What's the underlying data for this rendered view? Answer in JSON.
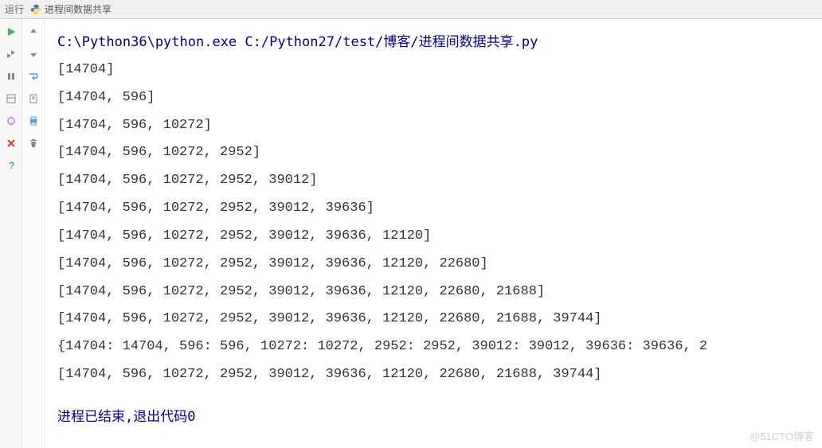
{
  "topbar": {
    "run_label": "运行",
    "tab_title": "进程间数据共享"
  },
  "toolbar": {
    "icons": {
      "play": "play",
      "rerun": "rerun",
      "pause": "pause",
      "stop": "stop",
      "debug": "debug",
      "close": "close",
      "help": "help",
      "up": "up",
      "down": "down",
      "print": "print",
      "wrap": "wrap",
      "scroll": "scroll",
      "trash": "trash",
      "layout": "layout"
    }
  },
  "output": {
    "path_line": "C:\\Python36\\python.exe C:/Python27/test/博客/进程间数据共享.py",
    "lines": [
      "[14704]",
      "[14704, 596]",
      "[14704, 596, 10272]",
      "[14704, 596, 10272, 2952]",
      "[14704, 596, 10272, 2952, 39012]",
      "[14704, 596, 10272, 2952, 39012, 39636]",
      "[14704, 596, 10272, 2952, 39012, 39636, 12120]",
      "[14704, 596, 10272, 2952, 39012, 39636, 12120, 22680]",
      "[14704, 596, 10272, 2952, 39012, 39636, 12120, 22680, 21688]",
      "[14704, 596, 10272, 2952, 39012, 39636, 12120, 22680, 21688, 39744]",
      "{14704: 14704, 596: 596, 10272: 10272, 2952: 2952, 39012: 39012, 39636: 39636, 2",
      "[14704, 596, 10272, 2952, 39012, 39636, 12120, 22680, 21688, 39744]"
    ],
    "end_line": "进程已结束,退出代码0"
  },
  "watermark": "@51CTO博客"
}
